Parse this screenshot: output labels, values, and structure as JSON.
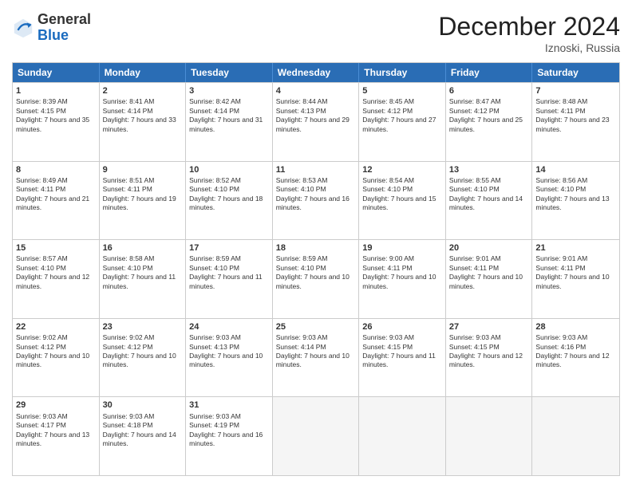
{
  "header": {
    "logo_general": "General",
    "logo_blue": "Blue",
    "month_title": "December 2024",
    "subtitle": "Iznoski, Russia"
  },
  "calendar": {
    "days_of_week": [
      "Sunday",
      "Monday",
      "Tuesday",
      "Wednesday",
      "Thursday",
      "Friday",
      "Saturday"
    ],
    "rows": [
      [
        {
          "day": "1",
          "sunrise": "8:39 AM",
          "sunset": "4:15 PM",
          "daylight": "7 hours and 35 minutes."
        },
        {
          "day": "2",
          "sunrise": "8:41 AM",
          "sunset": "4:14 PM",
          "daylight": "7 hours and 33 minutes."
        },
        {
          "day": "3",
          "sunrise": "8:42 AM",
          "sunset": "4:14 PM",
          "daylight": "7 hours and 31 minutes."
        },
        {
          "day": "4",
          "sunrise": "8:44 AM",
          "sunset": "4:13 PM",
          "daylight": "7 hours and 29 minutes."
        },
        {
          "day": "5",
          "sunrise": "8:45 AM",
          "sunset": "4:12 PM",
          "daylight": "7 hours and 27 minutes."
        },
        {
          "day": "6",
          "sunrise": "8:47 AM",
          "sunset": "4:12 PM",
          "daylight": "7 hours and 25 minutes."
        },
        {
          "day": "7",
          "sunrise": "8:48 AM",
          "sunset": "4:11 PM",
          "daylight": "7 hours and 23 minutes."
        }
      ],
      [
        {
          "day": "8",
          "sunrise": "8:49 AM",
          "sunset": "4:11 PM",
          "daylight": "7 hours and 21 minutes."
        },
        {
          "day": "9",
          "sunrise": "8:51 AM",
          "sunset": "4:11 PM",
          "daylight": "7 hours and 19 minutes."
        },
        {
          "day": "10",
          "sunrise": "8:52 AM",
          "sunset": "4:10 PM",
          "daylight": "7 hours and 18 minutes."
        },
        {
          "day": "11",
          "sunrise": "8:53 AM",
          "sunset": "4:10 PM",
          "daylight": "7 hours and 16 minutes."
        },
        {
          "day": "12",
          "sunrise": "8:54 AM",
          "sunset": "4:10 PM",
          "daylight": "7 hours and 15 minutes."
        },
        {
          "day": "13",
          "sunrise": "8:55 AM",
          "sunset": "4:10 PM",
          "daylight": "7 hours and 14 minutes."
        },
        {
          "day": "14",
          "sunrise": "8:56 AM",
          "sunset": "4:10 PM",
          "daylight": "7 hours and 13 minutes."
        }
      ],
      [
        {
          "day": "15",
          "sunrise": "8:57 AM",
          "sunset": "4:10 PM",
          "daylight": "7 hours and 12 minutes."
        },
        {
          "day": "16",
          "sunrise": "8:58 AM",
          "sunset": "4:10 PM",
          "daylight": "7 hours and 11 minutes."
        },
        {
          "day": "17",
          "sunrise": "8:59 AM",
          "sunset": "4:10 PM",
          "daylight": "7 hours and 11 minutes."
        },
        {
          "day": "18",
          "sunrise": "8:59 AM",
          "sunset": "4:10 PM",
          "daylight": "7 hours and 10 minutes."
        },
        {
          "day": "19",
          "sunrise": "9:00 AM",
          "sunset": "4:11 PM",
          "daylight": "7 hours and 10 minutes."
        },
        {
          "day": "20",
          "sunrise": "9:01 AM",
          "sunset": "4:11 PM",
          "daylight": "7 hours and 10 minutes."
        },
        {
          "day": "21",
          "sunrise": "9:01 AM",
          "sunset": "4:11 PM",
          "daylight": "7 hours and 10 minutes."
        }
      ],
      [
        {
          "day": "22",
          "sunrise": "9:02 AM",
          "sunset": "4:12 PM",
          "daylight": "7 hours and 10 minutes."
        },
        {
          "day": "23",
          "sunrise": "9:02 AM",
          "sunset": "4:12 PM",
          "daylight": "7 hours and 10 minutes."
        },
        {
          "day": "24",
          "sunrise": "9:03 AM",
          "sunset": "4:13 PM",
          "daylight": "7 hours and 10 minutes."
        },
        {
          "day": "25",
          "sunrise": "9:03 AM",
          "sunset": "4:14 PM",
          "daylight": "7 hours and 10 minutes."
        },
        {
          "day": "26",
          "sunrise": "9:03 AM",
          "sunset": "4:15 PM",
          "daylight": "7 hours and 11 minutes."
        },
        {
          "day": "27",
          "sunrise": "9:03 AM",
          "sunset": "4:15 PM",
          "daylight": "7 hours and 12 minutes."
        },
        {
          "day": "28",
          "sunrise": "9:03 AM",
          "sunset": "4:16 PM",
          "daylight": "7 hours and 12 minutes."
        }
      ],
      [
        {
          "day": "29",
          "sunrise": "9:03 AM",
          "sunset": "4:17 PM",
          "daylight": "7 hours and 13 minutes."
        },
        {
          "day": "30",
          "sunrise": "9:03 AM",
          "sunset": "4:18 PM",
          "daylight": "7 hours and 14 minutes."
        },
        {
          "day": "31",
          "sunrise": "9:03 AM",
          "sunset": "4:19 PM",
          "daylight": "7 hours and 16 minutes."
        },
        null,
        null,
        null,
        null
      ]
    ]
  }
}
